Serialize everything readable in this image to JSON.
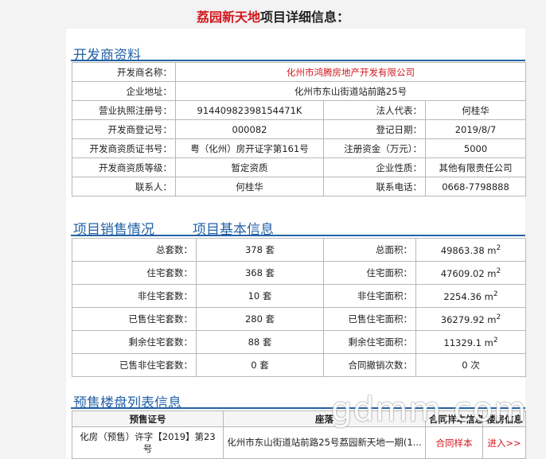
{
  "title": {
    "highlight": "荔园新天地",
    "rest": "项目详细信息："
  },
  "sections": {
    "developer": "开发商资料",
    "sales": "项目销售情况",
    "basic": "项目基本信息",
    "presale": "预售楼盘列表信息"
  },
  "developer": {
    "name_label": "开发商名称：",
    "name": "化州市鸿腾房地产开发有限公司",
    "address_label": "企业地址：",
    "address": "化州市东山街道站前路25号",
    "license_label": "营业执照注册号：",
    "license": "91440982398154471K",
    "legal_rep_label": "法人代表：",
    "legal_rep": "何桂华",
    "reg_no_label": "开发商登记号：",
    "reg_no": "000082",
    "reg_date_label": "登记日期：",
    "reg_date": "2019/8/7",
    "cert_label": "开发商资质证书号：",
    "cert": "粤（化州）房开证字第161号",
    "capital_label": "注册资金（万元）：",
    "capital": "5000",
    "grade_label": "开发商资质等级：",
    "grade": "暂定资质",
    "nature_label": "企业性质：",
    "nature": "其他有限责任公司",
    "contact_label": "联系人：",
    "contact": "何桂华",
    "phone_label": "联系电话：",
    "phone": "0668-7798888"
  },
  "sales": {
    "rows": [
      {
        "l1": "总套数：",
        "v1": "378 套",
        "l2": "总面积：",
        "v2": "49863.38 m"
      },
      {
        "l1": "住宅套数：",
        "v1": "368 套",
        "l2": "住宅面积：",
        "v2": "47609.02 m"
      },
      {
        "l1": "非住宅套数：",
        "v1": "10 套",
        "l2": "非住宅面积：",
        "v2": "2254.36 m"
      },
      {
        "l1": "已售住宅套数：",
        "v1": "280 套",
        "l2": "已售住宅面积：",
        "v2": "36279.92 m"
      },
      {
        "l1": "剩余住宅套数：",
        "v1": "88 套",
        "l2": "剩余住宅面积：",
        "v2": "11329.1 m"
      },
      {
        "l1": "已售非住宅套数：",
        "v1": "0 套",
        "l2": "合同撤销次数：",
        "v2": "0 次"
      }
    ],
    "sup": "2"
  },
  "presale": {
    "headers": [
      "预售证号",
      "座落",
      "合同样本信息",
      "楼房信息"
    ],
    "row": {
      "cert": "化房（预售）许字【2019】第23号",
      "location": "化州市东山街道站前路25号荔园新天地一期(1...",
      "contract": "合同样本",
      "enter": "进入>>"
    }
  },
  "watermark": "gdmm.com"
}
